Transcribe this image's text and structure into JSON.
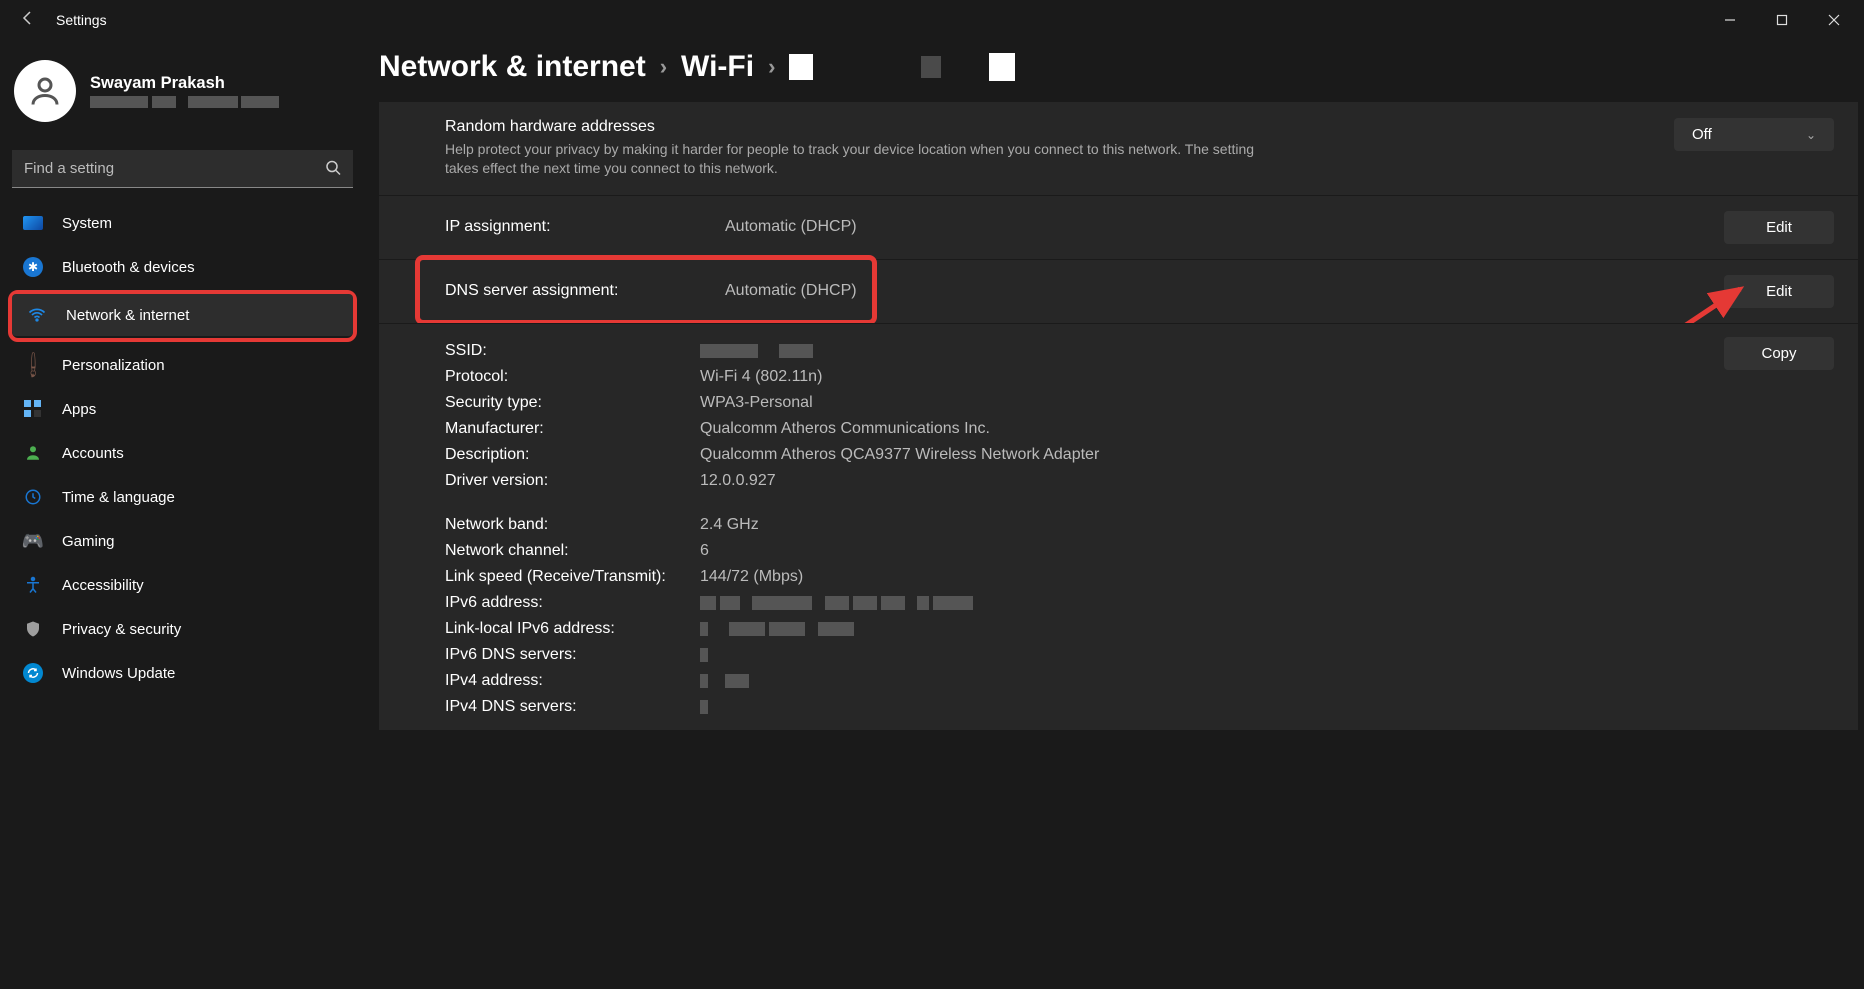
{
  "app": {
    "title": "Settings"
  },
  "profile": {
    "name": "Swayam Prakash"
  },
  "search": {
    "placeholder": "Find a setting"
  },
  "nav": {
    "system": "System",
    "bluetooth": "Bluetooth & devices",
    "network": "Network & internet",
    "personalization": "Personalization",
    "apps": "Apps",
    "accounts": "Accounts",
    "time": "Time & language",
    "gaming": "Gaming",
    "accessibility": "Accessibility",
    "privacy": "Privacy & security",
    "update": "Windows Update"
  },
  "breadcrumb": {
    "root": "Network & internet",
    "level1": "Wi-Fi"
  },
  "randomHw": {
    "title": "Random hardware addresses",
    "desc": "Help protect your privacy by making it harder for people to track your device location when you connect to this network. The setting takes effect the next time you connect to this network.",
    "value": "Off"
  },
  "ip": {
    "label": "IP assignment:",
    "value": "Automatic (DHCP)",
    "button": "Edit"
  },
  "dns": {
    "label": "DNS server assignment:",
    "value": "Automatic (DHCP)",
    "button": "Edit"
  },
  "copy": {
    "button": "Copy"
  },
  "props": {
    "ssid_l": "SSID:",
    "protocol_l": "Protocol:",
    "protocol_v": "Wi-Fi 4 (802.11n)",
    "security_l": "Security type:",
    "security_v": "WPA3-Personal",
    "manufacturer_l": "Manufacturer:",
    "manufacturer_v": "Qualcomm Atheros Communications Inc.",
    "description_l": "Description:",
    "description_v": "Qualcomm Atheros QCA9377 Wireless Network Adapter",
    "driver_l": "Driver version:",
    "driver_v": "12.0.0.927",
    "band_l": "Network band:",
    "band_v": "2.4 GHz",
    "channel_l": "Network channel:",
    "channel_v": "6",
    "speed_l": "Link speed (Receive/Transmit):",
    "speed_v": "144/72 (Mbps)",
    "ipv6_l": "IPv6 address:",
    "llipv6_l": "Link-local IPv6 address:",
    "ipv6dns_l": "IPv6 DNS servers:",
    "ipv4_l": "IPv4 address:",
    "ipv4dns_l": "IPv4 DNS servers:"
  }
}
